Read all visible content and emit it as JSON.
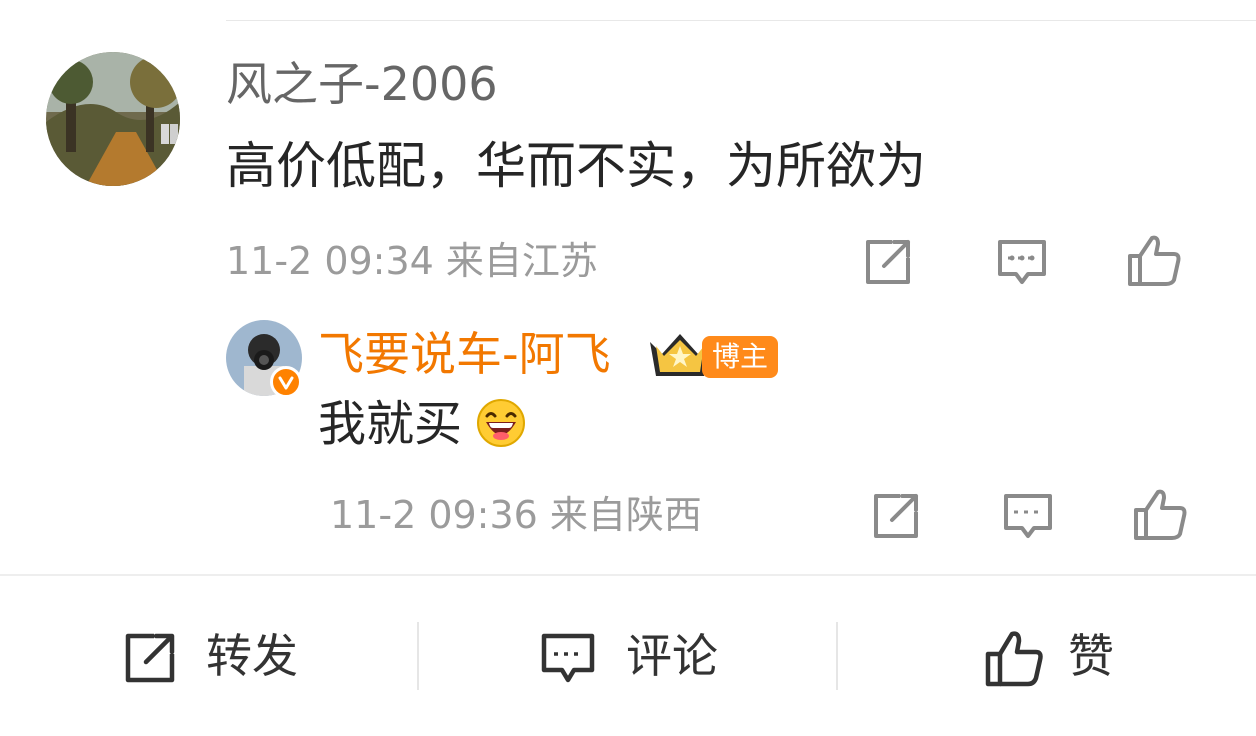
{
  "comment": {
    "username": "风之子-2006",
    "text": "高价低配，华而不实，为所欲为",
    "meta": "11-2 09:34 来自江苏"
  },
  "reply": {
    "username": "飞要说车-阿飞",
    "badge": "博主",
    "text": "我就买",
    "meta": "11-2 09:36 来自陕西"
  },
  "bottom_bar": {
    "repost_label": "转发",
    "comment_label": "评论",
    "like_label": "赞"
  },
  "colors": {
    "accent_orange": "#f27800",
    "meta_gray": "#9b9b9b",
    "icon_gray": "#8a8a8a"
  },
  "icons": {
    "share": "share-icon",
    "comment": "comment-icon",
    "like": "like-icon",
    "crown": "crown-icon",
    "emoji": "grin-emoji"
  }
}
